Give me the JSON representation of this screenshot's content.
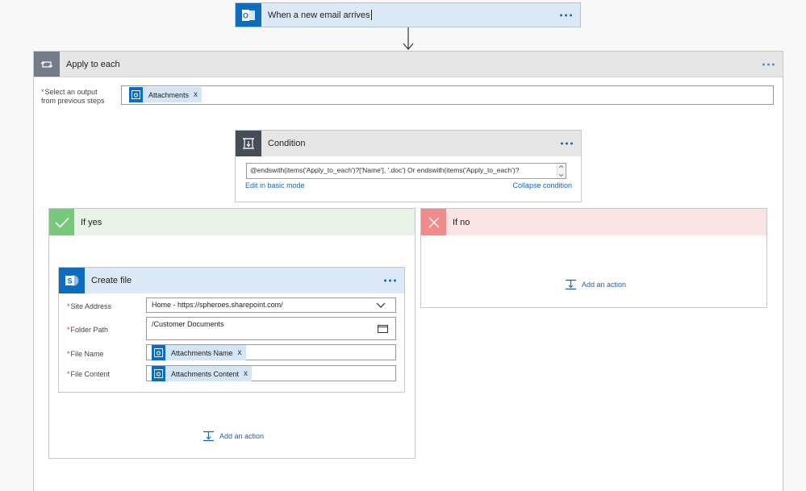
{
  "trigger": {
    "title": "When a new email arrives"
  },
  "apply": {
    "title": "Apply to each",
    "select_label_line1": "Select an output",
    "select_label_line2": "from previous steps",
    "token": "Attachments",
    "remove": "x"
  },
  "condition": {
    "title": "Condition",
    "expression": "@endswith(items('Apply_to_each')?['Name'], '.doc') Or endswith(items('Apply_to_each')?",
    "edit_basic": "Edit in basic mode",
    "collapse": "Collapse condition"
  },
  "if_yes": {
    "title": "If yes",
    "add_action": "Add an action"
  },
  "if_no": {
    "title": "If no",
    "add_action": "Add an action"
  },
  "create_file": {
    "title": "Create file",
    "site_label": "Site Address",
    "site_value": "Home - https://spheroes.sharepoint.com/",
    "folder_label": "Folder Path",
    "folder_value": "/Customer Documents",
    "filename_label": "File Name",
    "filename_token": "Attachments Name",
    "content_label": "File Content",
    "content_token": "Attachments Content",
    "remove": "x"
  },
  "required_mark": "*",
  "colors": {
    "accent": "#0f6cbd",
    "yes": "#77c97a",
    "no": "#f08b8b"
  }
}
